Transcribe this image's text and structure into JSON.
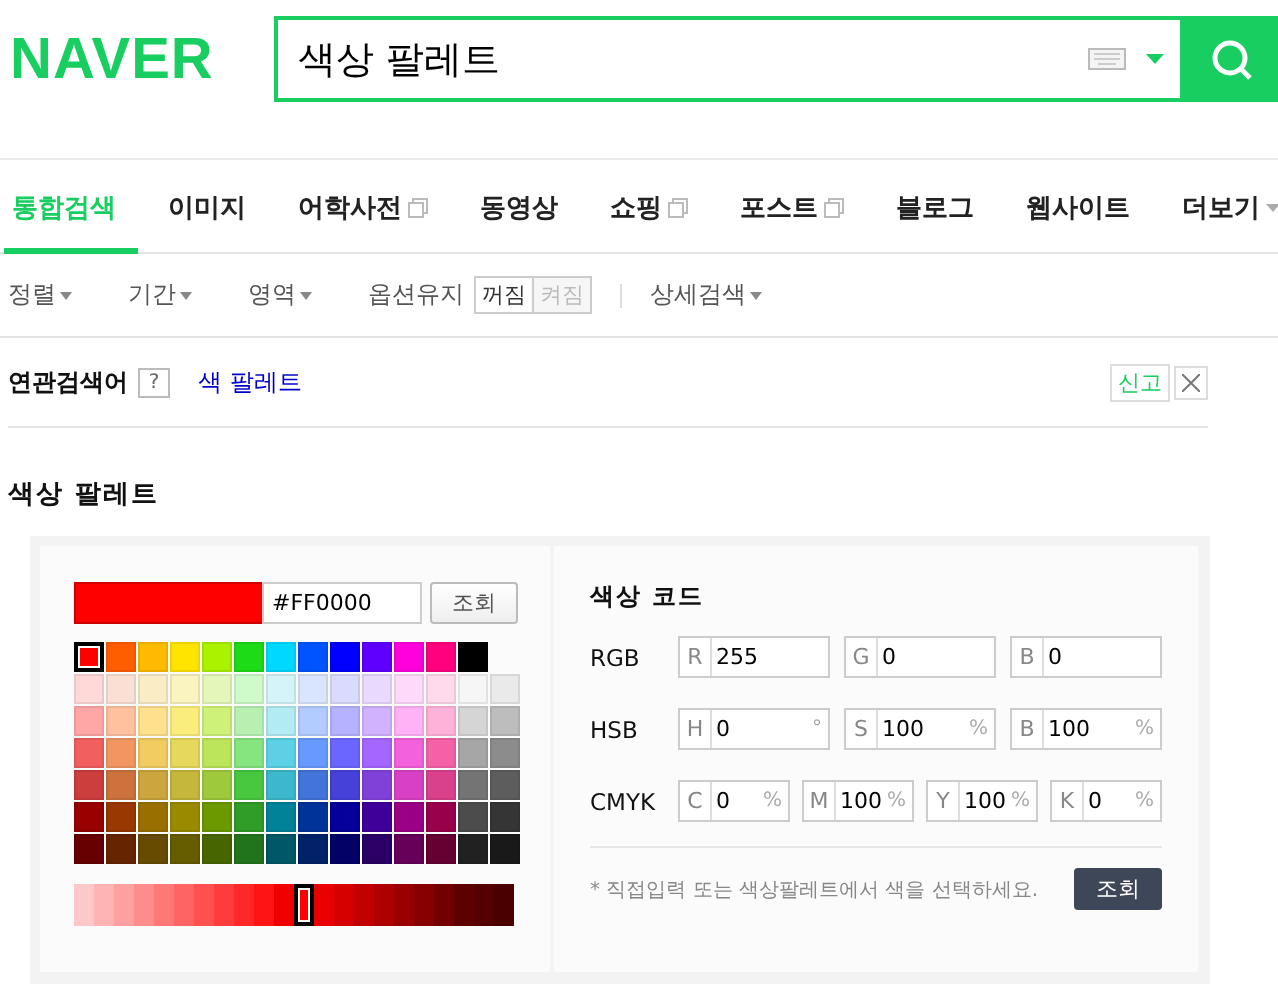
{
  "header": {
    "logo": "NAVER",
    "search": {
      "value": "색상 팔레트"
    }
  },
  "tabs": [
    {
      "label": "통합검색",
      "selected": true,
      "kind": "plain"
    },
    {
      "label": "이미지",
      "selected": false,
      "kind": "plain"
    },
    {
      "label": "어학사전",
      "selected": false,
      "kind": "popup"
    },
    {
      "label": "동영상",
      "selected": false,
      "kind": "plain"
    },
    {
      "label": "쇼핑",
      "selected": false,
      "kind": "popup"
    },
    {
      "label": "포스트",
      "selected": false,
      "kind": "popup"
    },
    {
      "label": "블로그",
      "selected": false,
      "kind": "plain"
    },
    {
      "label": "웹사이트",
      "selected": false,
      "kind": "plain"
    },
    {
      "label": "더보기",
      "selected": false,
      "kind": "more"
    }
  ],
  "filters": [
    {
      "kind": "dropdown",
      "label": "정렬"
    },
    {
      "kind": "dropdown",
      "label": "기간"
    },
    {
      "kind": "dropdown",
      "label": "영역"
    },
    {
      "kind": "toggle",
      "label": "옵션유지",
      "options": [
        {
          "label": "꺼짐",
          "selected": true
        },
        {
          "label": "켜짐",
          "selected": false
        }
      ]
    },
    {
      "kind": "dropdown",
      "label": "상세검색"
    }
  ],
  "related": {
    "label": "연관검색어",
    "help": "?",
    "links": [
      "색 팔레트"
    ],
    "report": "신고"
  },
  "palette": {
    "title": "색상 팔레트",
    "hex": "#FF0000",
    "lookup": "조회",
    "grid": [
      [
        {
          "color": "#ff0000",
          "selected": true
        },
        {
          "color": "#ff5e00",
          "selected": false
        },
        {
          "color": "#ffbb00",
          "selected": false
        },
        {
          "color": "#ffe400",
          "selected": false
        },
        {
          "color": "#abf200",
          "selected": false
        },
        {
          "color": "#1ddb16",
          "selected": false
        },
        {
          "color": "#00d8ff",
          "selected": false
        },
        {
          "color": "#0054ff",
          "selected": false
        },
        {
          "color": "#0100ff",
          "selected": false
        },
        {
          "color": "#5f00ff",
          "selected": false
        },
        {
          "color": "#ff00dd",
          "selected": false
        },
        {
          "color": "#ff007f",
          "selected": false
        },
        {
          "color": "#000000",
          "selected": false
        }
      ],
      [
        {
          "color": "#ffd8d8",
          "selected": false
        },
        {
          "color": "#fae0d4",
          "selected": false
        },
        {
          "color": "#faecc5",
          "selected": false
        },
        {
          "color": "#faf4c0",
          "selected": false
        },
        {
          "color": "#e4f7ba",
          "selected": false
        },
        {
          "color": "#cefbc9",
          "selected": false
        },
        {
          "color": "#d4f4fa",
          "selected": false
        },
        {
          "color": "#d9e5ff",
          "selected": false
        },
        {
          "color": "#dad9ff",
          "selected": false
        },
        {
          "color": "#e8d9ff",
          "selected": false
        },
        {
          "color": "#ffd9fa",
          "selected": false
        },
        {
          "color": "#ffd9ec",
          "selected": false
        },
        {
          "color": "#f6f6f6",
          "selected": false
        },
        {
          "color": "#eaeaea",
          "selected": false
        }
      ],
      [
        {
          "color": "#ffa7a7",
          "selected": false
        },
        {
          "color": "#ffc19e",
          "selected": false
        },
        {
          "color": "#ffe08c",
          "selected": false
        },
        {
          "color": "#faed7d",
          "selected": false
        },
        {
          "color": "#cef279",
          "selected": false
        },
        {
          "color": "#b7f0b1",
          "selected": false
        },
        {
          "color": "#b2ebf4",
          "selected": false
        },
        {
          "color": "#b2ccff",
          "selected": false
        },
        {
          "color": "#b5b2ff",
          "selected": false
        },
        {
          "color": "#d1b2ff",
          "selected": false
        },
        {
          "color": "#ffb2f5",
          "selected": false
        },
        {
          "color": "#ffb2d9",
          "selected": false
        },
        {
          "color": "#d5d5d5",
          "selected": false
        },
        {
          "color": "#bdbdbd",
          "selected": false
        }
      ],
      [
        {
          "color": "#f15f5f",
          "selected": false
        },
        {
          "color": "#f29661",
          "selected": false
        },
        {
          "color": "#f2cb61",
          "selected": false
        },
        {
          "color": "#e5d85c",
          "selected": false
        },
        {
          "color": "#bce55c",
          "selected": false
        },
        {
          "color": "#86e57f",
          "selected": false
        },
        {
          "color": "#5cd1e5",
          "selected": false
        },
        {
          "color": "#6799ff",
          "selected": false
        },
        {
          "color": "#6b66ff",
          "selected": false
        },
        {
          "color": "#a566ff",
          "selected": false
        },
        {
          "color": "#f361dc",
          "selected": false
        },
        {
          "color": "#f361a6",
          "selected": false
        },
        {
          "color": "#a6a6a6",
          "selected": false
        },
        {
          "color": "#8c8c8c",
          "selected": false
        }
      ],
      [
        {
          "color": "#cc3d3d",
          "selected": false
        },
        {
          "color": "#cc723d",
          "selected": false
        },
        {
          "color": "#cca63d",
          "selected": false
        },
        {
          "color": "#c4b73b",
          "selected": false
        },
        {
          "color": "#9fc93c",
          "selected": false
        },
        {
          "color": "#47c83e",
          "selected": false
        },
        {
          "color": "#3db7cc",
          "selected": false
        },
        {
          "color": "#4374d9",
          "selected": false
        },
        {
          "color": "#4641d9",
          "selected": false
        },
        {
          "color": "#8041d9",
          "selected": false
        },
        {
          "color": "#d941c5",
          "selected": false
        },
        {
          "color": "#d9418c",
          "selected": false
        },
        {
          "color": "#747474",
          "selected": false
        },
        {
          "color": "#5d5d5d",
          "selected": false
        }
      ],
      [
        {
          "color": "#980000",
          "selected": false
        },
        {
          "color": "#993800",
          "selected": false
        },
        {
          "color": "#997000",
          "selected": false
        },
        {
          "color": "#998a00",
          "selected": false
        },
        {
          "color": "#6b9900",
          "selected": false
        },
        {
          "color": "#2f9d27",
          "selected": false
        },
        {
          "color": "#008299",
          "selected": false
        },
        {
          "color": "#003399",
          "selected": false
        },
        {
          "color": "#050099",
          "selected": false
        },
        {
          "color": "#3f0099",
          "selected": false
        },
        {
          "color": "#990085",
          "selected": false
        },
        {
          "color": "#99004c",
          "selected": false
        },
        {
          "color": "#4c4c4c",
          "selected": false
        },
        {
          "color": "#353535",
          "selected": false
        }
      ],
      [
        {
          "color": "#670000",
          "selected": false
        },
        {
          "color": "#662500",
          "selected": false
        },
        {
          "color": "#664b00",
          "selected": false
        },
        {
          "color": "#665c00",
          "selected": false
        },
        {
          "color": "#476600",
          "selected": false
        },
        {
          "color": "#22741c",
          "selected": false
        },
        {
          "color": "#005766",
          "selected": false
        },
        {
          "color": "#002266",
          "selected": false
        },
        {
          "color": "#030066",
          "selected": false
        },
        {
          "color": "#2a0066",
          "selected": false
        },
        {
          "color": "#660058",
          "selected": false
        },
        {
          "color": "#660033",
          "selected": false
        },
        {
          "color": "#212121",
          "selected": false
        },
        {
          "color": "#191919",
          "selected": false
        }
      ]
    ],
    "shades": [
      {
        "color": "#ffc8c8",
        "selected": false
      },
      {
        "color": "#ffb4b4",
        "selected": false
      },
      {
        "color": "#ffa0a0",
        "selected": false
      },
      {
        "color": "#ff8c8c",
        "selected": false
      },
      {
        "color": "#ff7878",
        "selected": false
      },
      {
        "color": "#ff6464",
        "selected": false
      },
      {
        "color": "#ff5050",
        "selected": false
      },
      {
        "color": "#ff3c3c",
        "selected": false
      },
      {
        "color": "#ff2828",
        "selected": false
      },
      {
        "color": "#ff1414",
        "selected": false
      },
      {
        "color": "#f00000",
        "selected": false
      },
      {
        "color": "#ff0000",
        "selected": true
      },
      {
        "color": "#eb0000",
        "selected": false
      },
      {
        "color": "#d70000",
        "selected": false
      },
      {
        "color": "#c30000",
        "selected": false
      },
      {
        "color": "#af0000",
        "selected": false
      },
      {
        "color": "#9b0000",
        "selected": false
      },
      {
        "color": "#870000",
        "selected": false
      },
      {
        "color": "#730000",
        "selected": false
      },
      {
        "color": "#5f0000",
        "selected": false
      },
      {
        "color": "#550000",
        "selected": false
      },
      {
        "color": "#4b0000",
        "selected": false
      }
    ],
    "code": {
      "title": "색상 코드",
      "groups": [
        {
          "label": "RGB",
          "fields": [
            {
              "letter": "R",
              "value": "255"
            },
            {
              "letter": "G",
              "value": "0"
            },
            {
              "letter": "B",
              "value": "0"
            }
          ]
        },
        {
          "label": "HSB",
          "fields": [
            {
              "letter": "H",
              "value": "0",
              "unit": "°"
            },
            {
              "letter": "S",
              "value": "100",
              "unit": "%"
            },
            {
              "letter": "B",
              "value": "100",
              "unit": "%"
            }
          ]
        },
        {
          "label": "CMYK",
          "fields": [
            {
              "letter": "C",
              "value": "0",
              "unit": "%"
            },
            {
              "letter": "M",
              "value": "100",
              "unit": "%"
            },
            {
              "letter": "Y",
              "value": "100",
              "unit": "%"
            },
            {
              "letter": "K",
              "value": "0",
              "unit": "%"
            }
          ]
        }
      ],
      "note": "* 직접입력 또는 색상팔레트에서 색을 선택하세요.",
      "button": "조회"
    }
  }
}
